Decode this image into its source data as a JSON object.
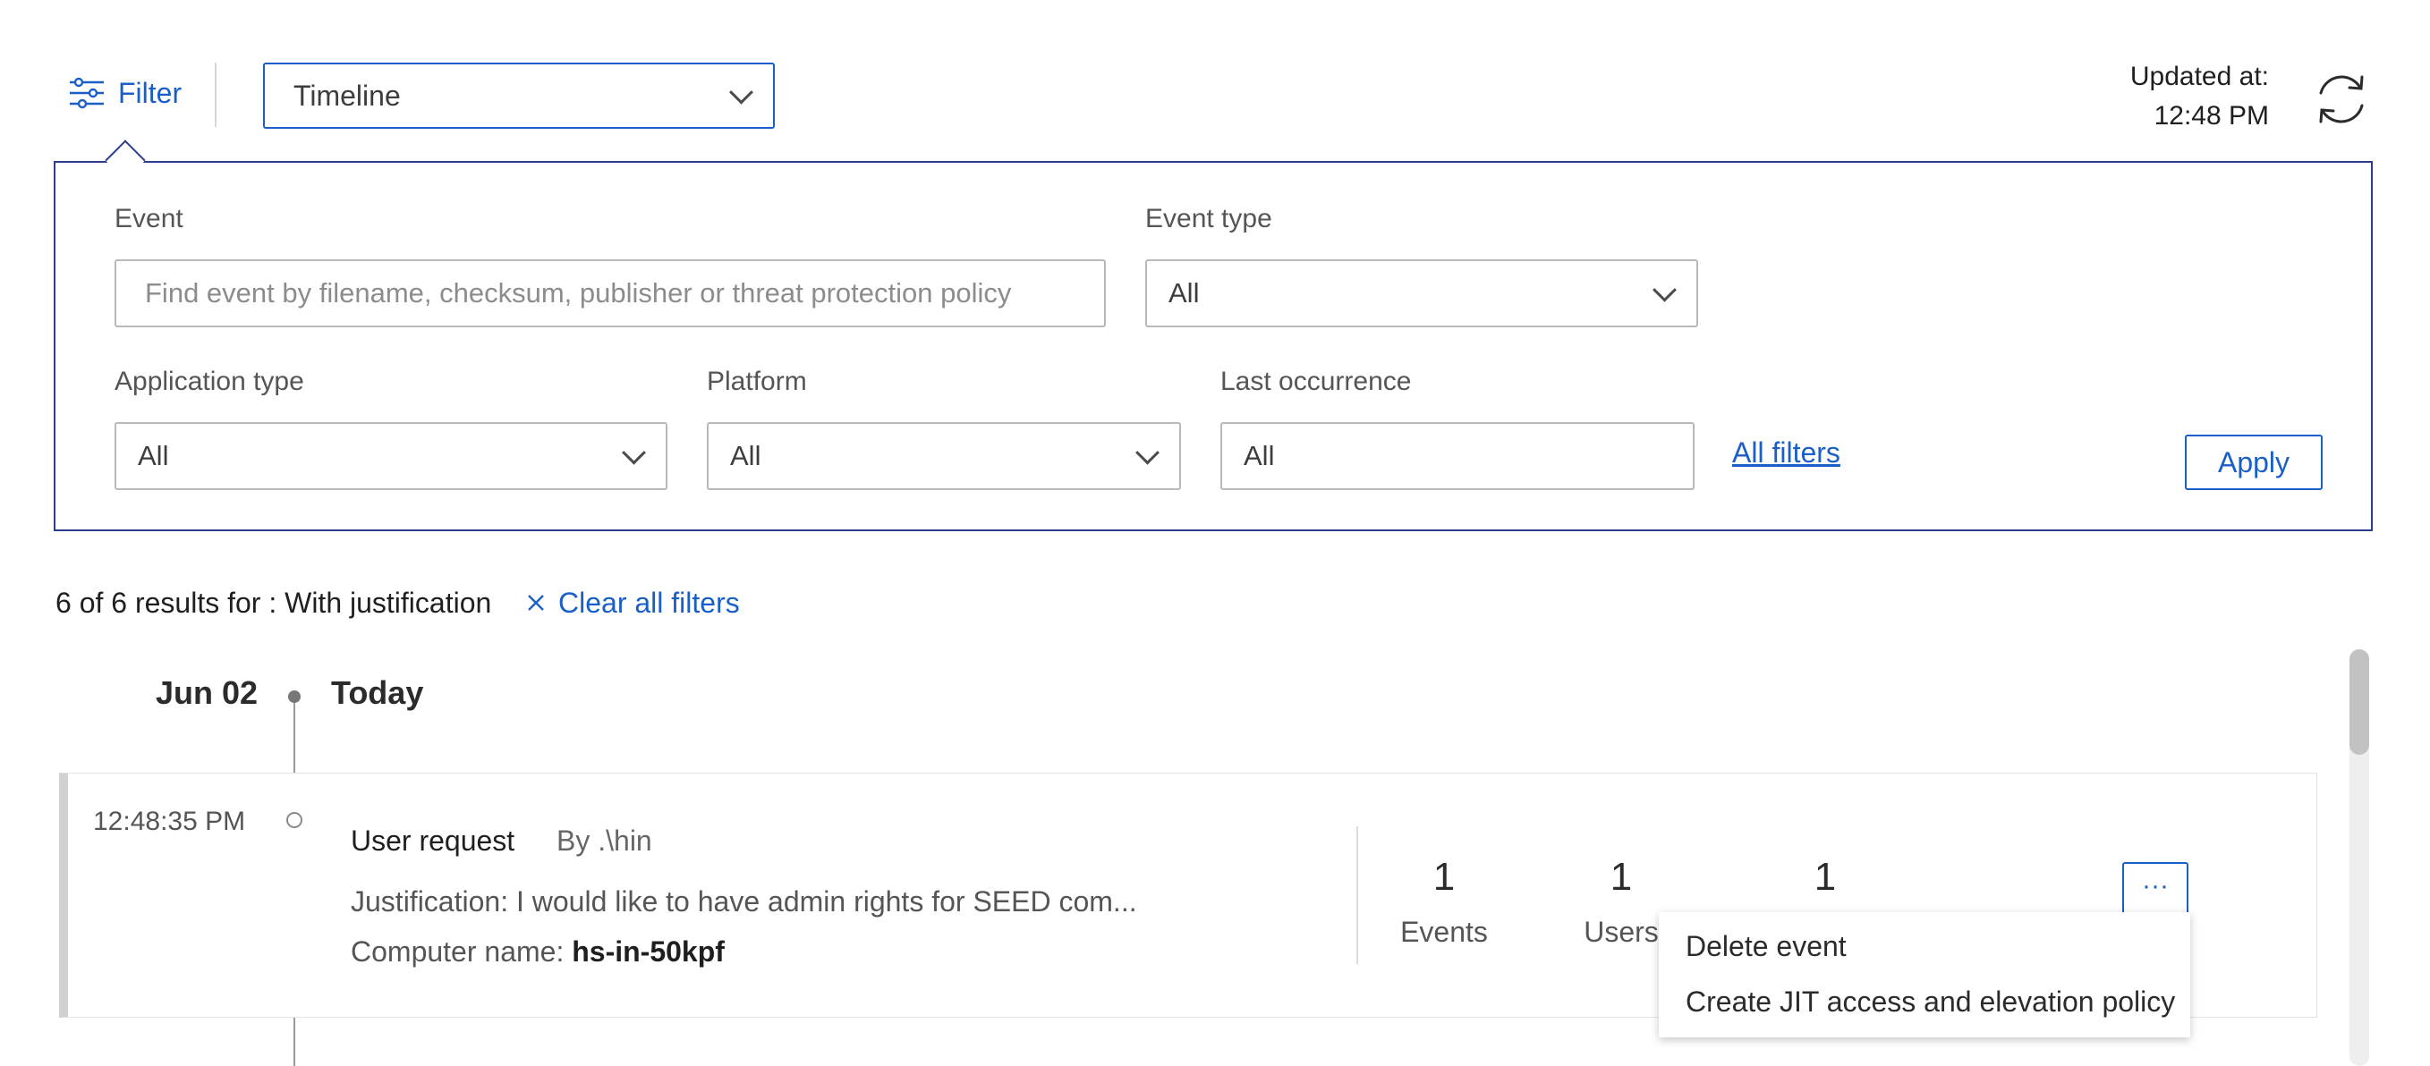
{
  "topbar": {
    "filter_label": "Filter",
    "view_select_value": "Timeline",
    "updated_label": "Updated at:",
    "updated_time": "12:48 PM"
  },
  "filters": {
    "event_label": "Event",
    "event_placeholder": "Find event by filename, checksum, publisher or threat protection policy",
    "event_type_label": "Event type",
    "event_type_value": "All",
    "application_type_label": "Application type",
    "application_type_value": "All",
    "platform_label": "Platform",
    "platform_value": "All",
    "last_occurrence_label": "Last occurrence",
    "last_occurrence_value": "All",
    "all_filters_link": "All filters",
    "apply_label": "Apply"
  },
  "results": {
    "summary": "6 of 6 results for : With justification",
    "clear_all_label": "Clear all filters"
  },
  "timeline": {
    "date": "Jun 02",
    "day_label": "Today",
    "event": {
      "time": "12:48:35 PM",
      "type": "User request",
      "by": "By .\\hin",
      "justification": "Justification: I would like to have admin rights for SEED com...",
      "computer_label": "Computer name:",
      "computer_value": "hs-in-50kpf",
      "stats": [
        {
          "value": "1",
          "label": "Events"
        },
        {
          "value": "1",
          "label": "Users"
        },
        {
          "value": "1",
          "label": ""
        }
      ],
      "more_label": "···"
    }
  },
  "context_menu": {
    "items": [
      "Delete event",
      "Create JIT access and elevation policy"
    ]
  },
  "colors": {
    "accent": "#1a5fc7",
    "panel_border": "#2a3d8f",
    "text": "#2b2b2b",
    "muted": "#555555"
  }
}
